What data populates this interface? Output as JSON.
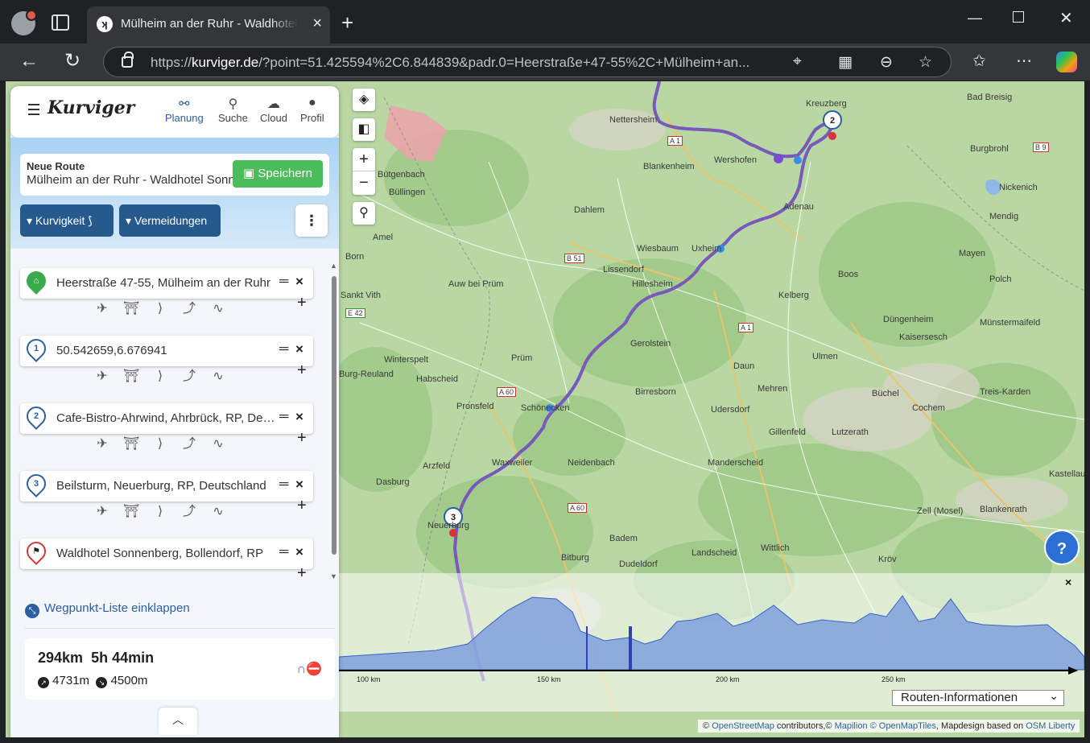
{
  "browser": {
    "tab_title": "Mülheim an der Ruhr - Waldhotel",
    "url_prefix": "https://",
    "url_domain": "kurviger.de",
    "url_rest": "/?point=51.425594%2C6.844839&padr.0=Heerstraße+47-55%2C+Mülheim+an...",
    "new_tab": "+",
    "tab_close": "×"
  },
  "app": {
    "logo": "Kurviger",
    "nav": [
      {
        "label": "Planung",
        "icon": "route-icon"
      },
      {
        "label": "Suche",
        "icon": "search-icon"
      },
      {
        "label": "Cloud",
        "icon": "cloud-icon"
      },
      {
        "label": "Profil",
        "icon": "user-icon"
      }
    ],
    "route": {
      "label": "Neue Route",
      "name": "Mülheim an der Ruhr - Waldhotel Sonnenberg",
      "save_label": "Speichern"
    },
    "kurvigkeit_label": "Kurvigkeit",
    "vermeidungen_label": "Vermeidungen",
    "waypoints": [
      {
        "marker": "home",
        "text": "Heerstraße 47-55, Mülheim an der Ruhr"
      },
      {
        "marker": "1",
        "text": "50.542659,6.676941"
      },
      {
        "marker": "2",
        "text": "Cafe-Bistro-Ahrwind, Ahrbrück, RP, Deutschland"
      },
      {
        "marker": "3",
        "text": "Beilsturm, Neuerburg, RP, Deutschland"
      },
      {
        "marker": "flag",
        "text": "Waldhotel Sonnenberg, Bollendorf, RP"
      }
    ],
    "collapse_label": "Wegpunkt-Liste einklappen",
    "summary": {
      "distance": "294km",
      "duration": "5h 44min",
      "ascent": "4731m",
      "descent": "4500m"
    }
  },
  "map": {
    "places": [
      {
        "name": "Nettersheim"
      },
      {
        "name": "Blankenheim"
      },
      {
        "name": "Wershofen"
      },
      {
        "name": "Kreuzberg"
      },
      {
        "name": "Bad Breisig"
      },
      {
        "name": "Burgbrohl"
      },
      {
        "name": "Nickenich"
      },
      {
        "name": "Mendig"
      },
      {
        "name": "Mayen"
      },
      {
        "name": "Dahlem"
      },
      {
        "name": "Adenau"
      },
      {
        "name": "Bütgenbach"
      },
      {
        "name": "Büllingen"
      },
      {
        "name": "Amel"
      },
      {
        "name": "Wiesbaum"
      },
      {
        "name": "Uxheim"
      },
      {
        "name": "Lissendorf"
      },
      {
        "name": "Hillesheim"
      },
      {
        "name": "Boos"
      },
      {
        "name": "Polch"
      },
      {
        "name": "Kelberg"
      },
      {
        "name": "Düngenheim"
      },
      {
        "name": "Münstermaifeld"
      },
      {
        "name": "Kaisersesch"
      },
      {
        "name": "Gerolstein"
      },
      {
        "name": "Ulmen"
      },
      {
        "name": "Prüm"
      },
      {
        "name": "Daun"
      },
      {
        "name": "Winterspelt"
      },
      {
        "name": "Habscheid"
      },
      {
        "name": "Birresborn"
      },
      {
        "name": "Mehren"
      },
      {
        "name": "Büchel"
      },
      {
        "name": "Treis-Karden"
      },
      {
        "name": "Pronsfeld"
      },
      {
        "name": "Schönecken"
      },
      {
        "name": "Udersdorf"
      },
      {
        "name": "Gillenfeld"
      },
      {
        "name": "Lutzerath"
      },
      {
        "name": "Cochem"
      },
      {
        "name": "Arzfeld"
      },
      {
        "name": "Waxweiler"
      },
      {
        "name": "Neidenbach"
      },
      {
        "name": "Manderscheid"
      },
      {
        "name": "Dasburg"
      },
      {
        "name": "Neuerburg"
      },
      {
        "name": "Zell (Mosel)"
      },
      {
        "name": "Blankenrath"
      },
      {
        "name": "Bitburg"
      },
      {
        "name": "Wittlich"
      },
      {
        "name": "Landscheid"
      },
      {
        "name": "Badem"
      },
      {
        "name": "Dudeldorf"
      },
      {
        "name": "Kröv"
      },
      {
        "name": "Born"
      },
      {
        "name": "Sankt Vith"
      },
      {
        "name": "Burg-Reuland"
      },
      {
        "name": "Auw bei Prüm"
      },
      {
        "name": "Dasburg"
      },
      {
        "name": "Kastellaun"
      }
    ],
    "roads": [
      "A 1",
      "B 51",
      "A 1",
      "A 60",
      "A 60",
      "A 1",
      "B 9",
      "E 42"
    ],
    "route_color": "#8b3f7a",
    "help_label": "?"
  },
  "elevation": {
    "ticks": [
      "100 km",
      "150 km",
      "200 km",
      "250 km"
    ],
    "select_value": "Routen-Informationen",
    "close": "×"
  },
  "attribution": {
    "prefix": "©",
    "osm": "OpenStreetMap",
    "contrib": "contributors,©",
    "mapilion": "Mapilion",
    "sep": "©",
    "omt": "OpenMapTiles",
    "based": ", Mapdesign based on",
    "liberty": "OSM Liberty"
  }
}
